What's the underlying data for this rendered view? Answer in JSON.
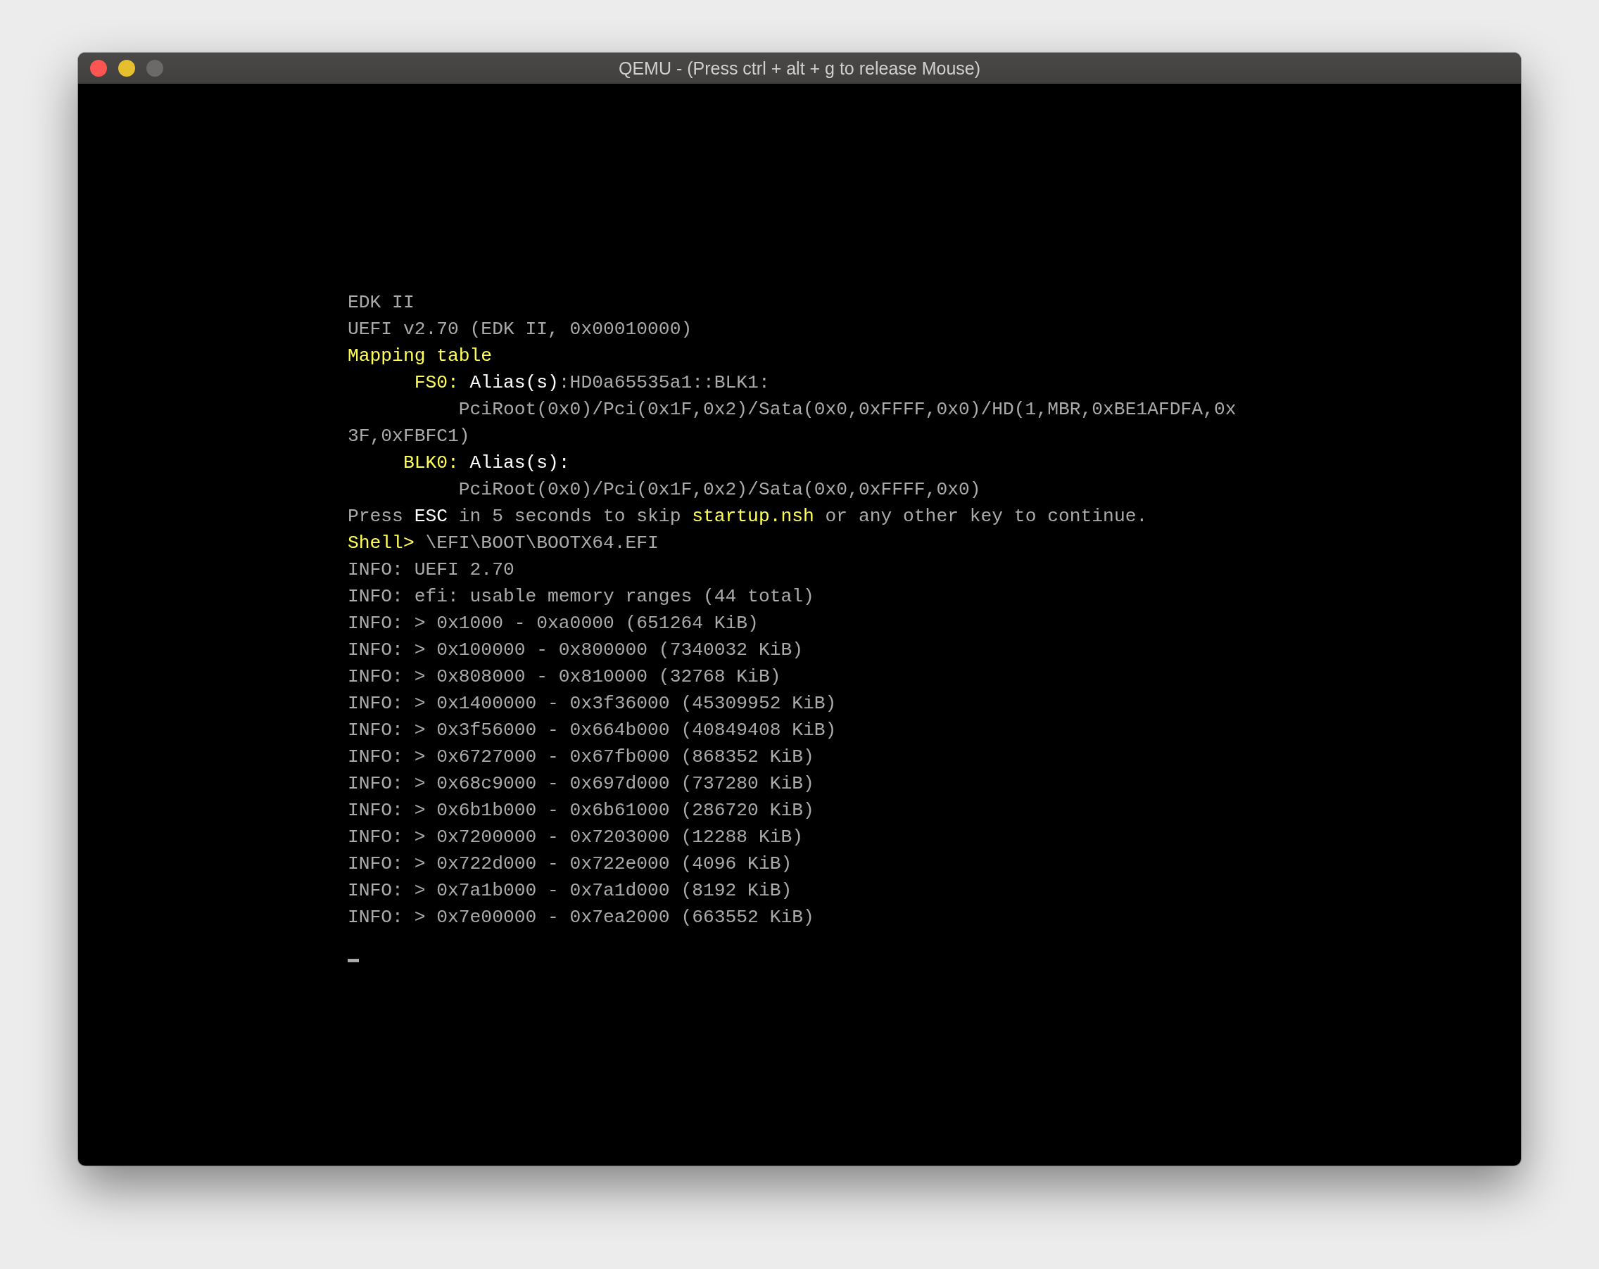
{
  "window": {
    "title": "QEMU - (Press ctrl + alt + g to release Mouse)",
    "controls": [
      {
        "kind": "close",
        "disabled": false
      },
      {
        "kind": "minimize",
        "disabled": false
      },
      {
        "kind": "zoom",
        "disabled": true
      }
    ]
  },
  "console": {
    "cursor": true,
    "lines": [
      [
        {
          "kind": "normal",
          "text": "EDK II"
        }
      ],
      [
        {
          "kind": "normal",
          "text": "UEFI v2.70 (EDK II, 0x00010000)"
        }
      ],
      [
        {
          "kind": "yellow",
          "text": "Mapping table"
        }
      ],
      [
        {
          "kind": "yellow",
          "text": "      FS0: "
        },
        {
          "kind": "bright",
          "text": "Alias(s)"
        },
        {
          "kind": "normal",
          "text": ":HD0a65535a1::BLK1:"
        }
      ],
      [
        {
          "kind": "normal",
          "text": "          PciRoot(0x0)/Pci(0x1F,0x2)/Sata(0x0,0xFFFF,0x0)/HD(1,MBR,0xBE1AFDFA,0x"
        }
      ],
      [
        {
          "kind": "normal",
          "text": "3F,0xFBFC1)"
        }
      ],
      [
        {
          "kind": "yellow",
          "text": "     BLK0: "
        },
        {
          "kind": "bright",
          "text": "Alias(s):"
        }
      ],
      [
        {
          "kind": "normal",
          "text": "          PciRoot(0x0)/Pci(0x1F,0x2)/Sata(0x0,0xFFFF,0x0)"
        }
      ],
      [
        {
          "kind": "normal",
          "text": "Press "
        },
        {
          "kind": "bright",
          "text": "ESC"
        },
        {
          "kind": "normal",
          "text": " in 5 seconds to skip "
        },
        {
          "kind": "yellow",
          "text": "startup.nsh"
        },
        {
          "kind": "normal",
          "text": " or any other key to continue."
        }
      ],
      [
        {
          "kind": "yellow",
          "text": "Shell> "
        },
        {
          "kind": "normal",
          "text": "\\EFI\\BOOT\\BOOTX64.EFI"
        }
      ],
      [
        {
          "kind": "normal",
          "text": "INFO: UEFI 2.70"
        }
      ],
      [
        {
          "kind": "normal",
          "text": "INFO: efi: usable memory ranges (44 total)"
        }
      ],
      [
        {
          "kind": "normal",
          "text": "INFO: > 0x1000 - 0xa0000 (651264 KiB)"
        }
      ],
      [
        {
          "kind": "normal",
          "text": "INFO: > 0x100000 - 0x800000 (7340032 KiB)"
        }
      ],
      [
        {
          "kind": "normal",
          "text": "INFO: > 0x808000 - 0x810000 (32768 KiB)"
        }
      ],
      [
        {
          "kind": "normal",
          "text": "INFO: > 0x1400000 - 0x3f36000 (45309952 KiB)"
        }
      ],
      [
        {
          "kind": "normal",
          "text": "INFO: > 0x3f56000 - 0x664b000 (40849408 KiB)"
        }
      ],
      [
        {
          "kind": "normal",
          "text": "INFO: > 0x6727000 - 0x67fb000 (868352 KiB)"
        }
      ],
      [
        {
          "kind": "normal",
          "text": "INFO: > 0x68c9000 - 0x697d000 (737280 KiB)"
        }
      ],
      [
        {
          "kind": "normal",
          "text": "INFO: > 0x6b1b000 - 0x6b61000 (286720 KiB)"
        }
      ],
      [
        {
          "kind": "normal",
          "text": "INFO: > 0x7200000 - 0x7203000 (12288 KiB)"
        }
      ],
      [
        {
          "kind": "normal",
          "text": "INFO: > 0x722d000 - 0x722e000 (4096 KiB)"
        }
      ],
      [
        {
          "kind": "normal",
          "text": "INFO: > 0x7a1b000 - 0x7a1d000 (8192 KiB)"
        }
      ],
      [
        {
          "kind": "normal",
          "text": "INFO: > 0x7e00000 - 0x7ea2000 (663552 KiB)"
        }
      ]
    ]
  }
}
